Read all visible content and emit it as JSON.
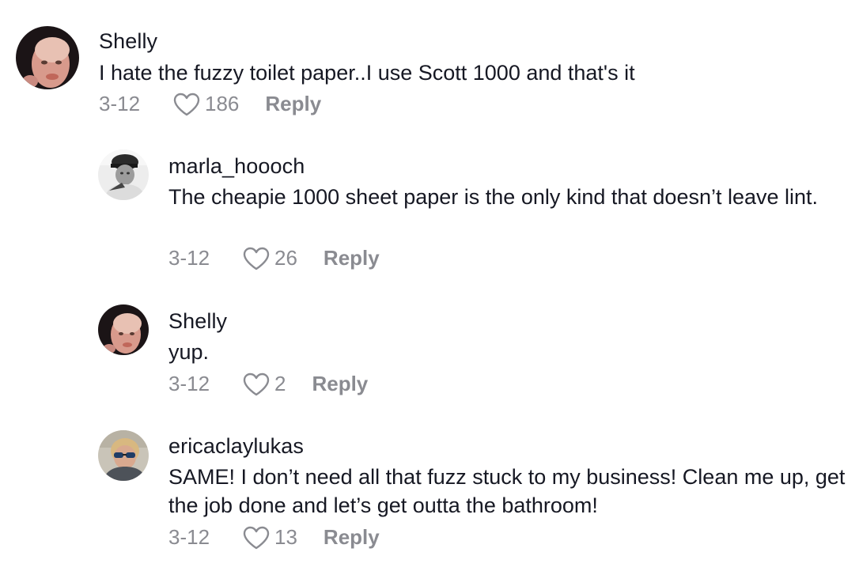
{
  "comments": [
    {
      "username": "Shelly",
      "text": "I hate the fuzzy toilet paper..I use Scott 1000 and that's it",
      "date": "3-12",
      "likes": "186",
      "reply_label": "Reply",
      "avatar_icon": "profile-photo-shelly"
    },
    {
      "username": "marla_hoooch",
      "text": "The cheapie 1000 sheet paper is the only kind that doesn’t leave lint.",
      "date": "3-12",
      "likes": "26",
      "reply_label": "Reply",
      "avatar_icon": "profile-photo-marla"
    },
    {
      "username": "Shelly",
      "text": "yup.",
      "date": "3-12",
      "likes": "2",
      "reply_label": "Reply",
      "avatar_icon": "profile-photo-shelly"
    },
    {
      "username": "ericaclaylukas",
      "text": "SAME! I don’t need all that fuzz stuck to my business! Clean me up, get the job done and let’s get outta the bathroom!",
      "date": "3-12",
      "likes": "13",
      "reply_label": "Reply",
      "avatar_icon": "profile-photo-erica"
    }
  ],
  "colors": {
    "text": "#161823",
    "muted": "#8a8b91",
    "background": "#ffffff"
  }
}
